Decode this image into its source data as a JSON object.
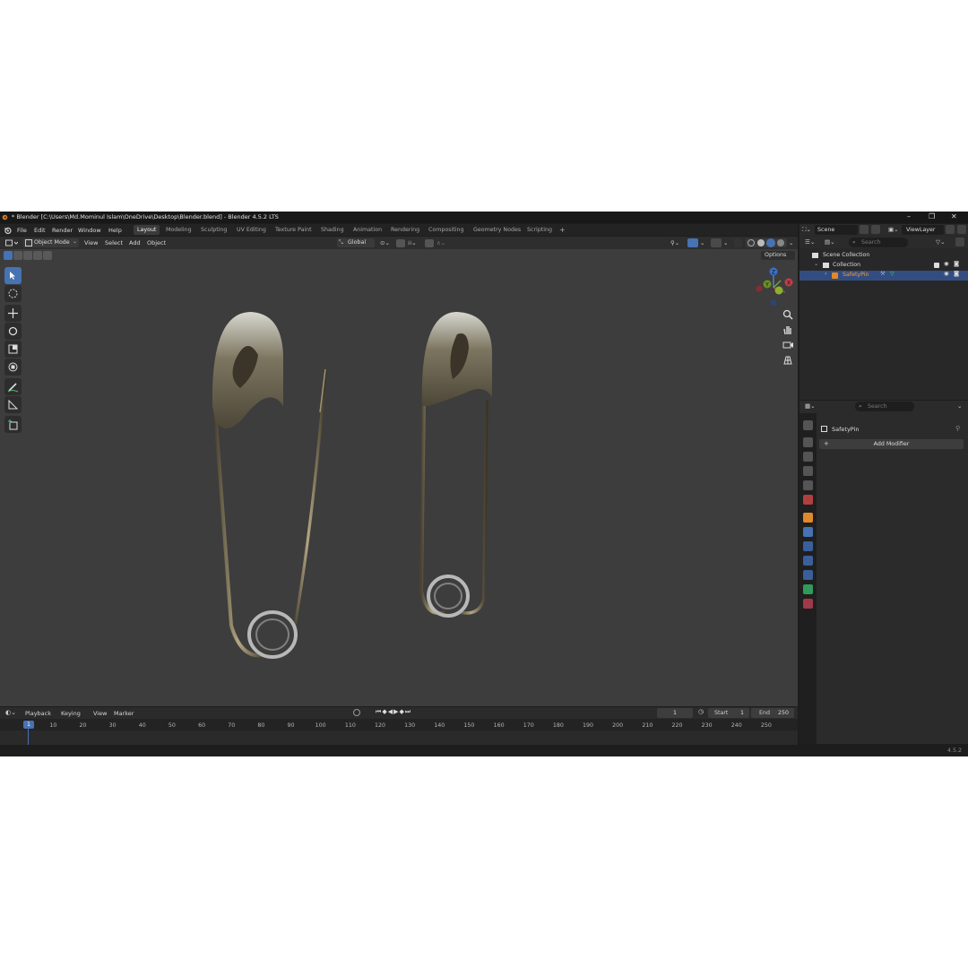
{
  "window": {
    "title": "* Blender [C:\\Users\\Md.Mominul Islam\\OneDrive\\Desktop\\Blender.blend] - Blender 4.5.2 LTS",
    "minimize": "–",
    "maximize": "❐",
    "close": "✕"
  },
  "menu": [
    "File",
    "Edit",
    "Render",
    "Window",
    "Help"
  ],
  "workspaces": [
    "Layout",
    "Modeling",
    "Sculpting",
    "UV Editing",
    "Texture Paint",
    "Shading",
    "Animation",
    "Rendering",
    "Compositing",
    "Geometry Nodes",
    "Scripting"
  ],
  "workspace_add": "+",
  "scene": {
    "name": "Scene",
    "viewlayer": "ViewLayer"
  },
  "viewport_header": {
    "mode": "Object Mode",
    "menus": [
      "View",
      "Select",
      "Add",
      "Object"
    ],
    "orientation": "Global",
    "options": "Options"
  },
  "gizmo": {
    "z": "Z",
    "y": "Y",
    "x": "X"
  },
  "outliner": {
    "search_placeholder": "Search",
    "scene_collection": "Scene Collection",
    "collection": "Collection",
    "object": "SafetyPin"
  },
  "properties": {
    "search_placeholder": "Search",
    "object": "SafetyPin",
    "add_modifier": "Add Modifier"
  },
  "timeline": {
    "menus": [
      "Playback",
      "Keying",
      "View",
      "Marker"
    ],
    "current_frame": "1",
    "start_label": "Start",
    "start": "1",
    "end_label": "End",
    "end": "250",
    "playhead": "1",
    "ticks": [
      "10",
      "20",
      "30",
      "40",
      "50",
      "60",
      "70",
      "80",
      "90",
      "100",
      "110",
      "120",
      "130",
      "140",
      "150",
      "160",
      "170",
      "180",
      "190",
      "200",
      "210",
      "220",
      "230",
      "240",
      "250"
    ]
  },
  "status": {
    "version": "4.5.2"
  },
  "colors": {
    "accent": "#4772b3",
    "viewport_bg": "#3d3d3d",
    "selected_row": "#334d80"
  }
}
